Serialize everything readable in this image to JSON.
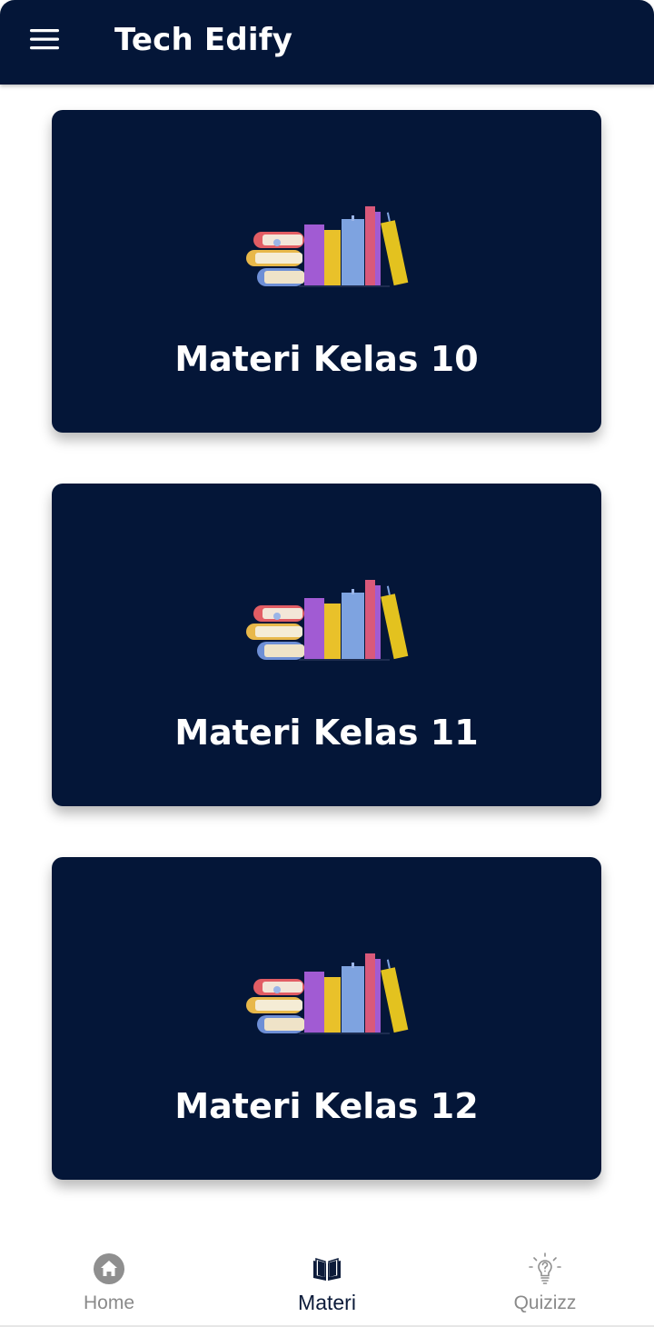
{
  "header": {
    "menu_icon": "hamburger-menu-icon",
    "title": "Tech Edify"
  },
  "cards": [
    {
      "label": "Materi Kelas 10",
      "icon": "books-stack-icon"
    },
    {
      "label": "Materi Kelas 11",
      "icon": "books-stack-icon"
    },
    {
      "label": "Materi Kelas 12",
      "icon": "books-stack-icon"
    }
  ],
  "bottom_nav": {
    "items": [
      {
        "label": "Home",
        "icon": "home-icon",
        "active": false
      },
      {
        "label": "Materi",
        "icon": "open-book-icon",
        "active": true
      },
      {
        "label": "Quizizz",
        "icon": "lightbulb-question-icon",
        "active": false
      }
    ]
  },
  "colors": {
    "primary_dark": "#041638",
    "inactive_nav": "#8a8a8a",
    "active_nav": "#0c1b3a"
  }
}
